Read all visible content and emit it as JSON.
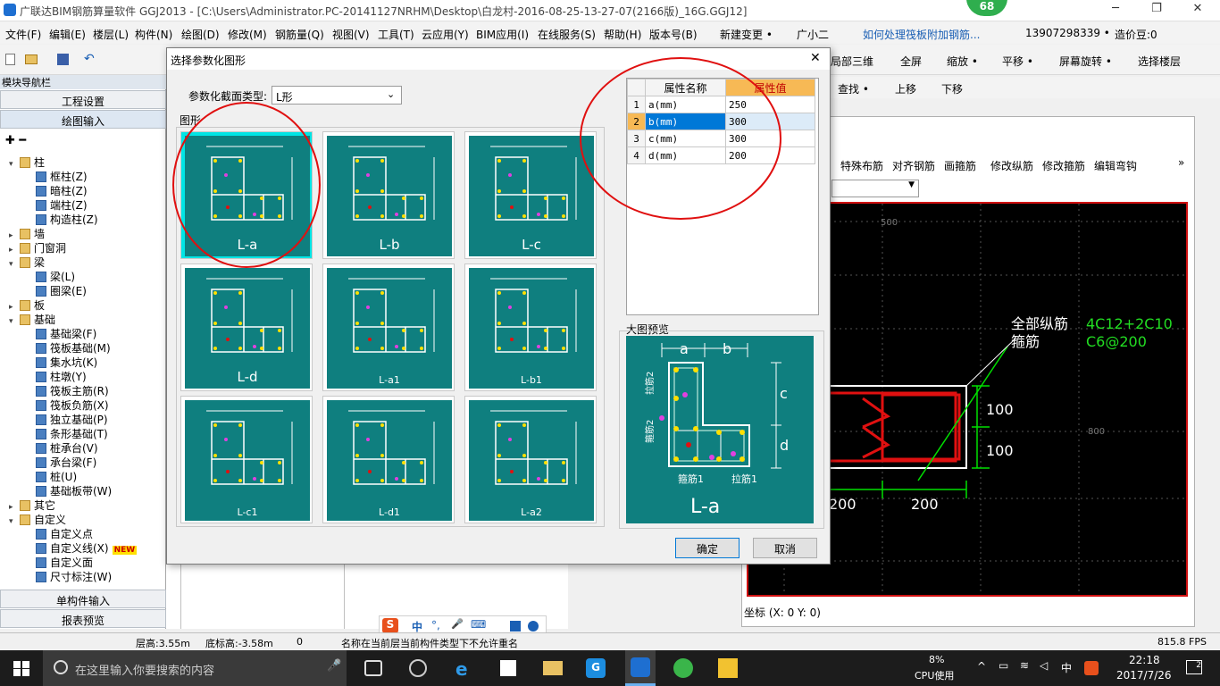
{
  "window": {
    "title": "广联达BIM钢筋算量软件 GGJ2013 - [C:\\Users\\Administrator.PC-20141127NRHM\\Desktop\\白龙村-2016-08-25-13-27-07(2166版)_16G.GGJ12]",
    "badge": "68",
    "minimize": "─",
    "maximize": "❐",
    "close": "✕"
  },
  "menu": [
    "文件(F)",
    "编辑(E)",
    "楼层(L)",
    "构件(N)",
    "绘图(D)",
    "修改(M)",
    "钢筋量(Q)",
    "视图(V)",
    "工具(T)",
    "云应用(Y)",
    "BIM应用(I)",
    "在线服务(S)",
    "帮助(H)",
    "版本号(B)",
    "新建变更 •",
    "广小二",
    "如何处理筏板附加钢筋...",
    "13907298339 •",
    "造价豆:0"
  ],
  "toolbar": {
    "items": [
      "局部三维",
      "全屏",
      "缩放 •",
      "平移 •",
      "屏幕旋转 •",
      "选择楼层"
    ],
    "row2": [
      "查找 •",
      "上移",
      "下移"
    ]
  },
  "nav": {
    "header": "模块导航栏",
    "buttons": [
      "工程设置",
      "绘图输入",
      "单构件输入",
      "报表预览"
    ],
    "tree": [
      {
        "t": "柱",
        "lvl": 0,
        "k": "folder",
        "open": true
      },
      {
        "t": "框柱(Z)",
        "lvl": 1,
        "k": "leaf"
      },
      {
        "t": "暗柱(Z)",
        "lvl": 1,
        "k": "leaf"
      },
      {
        "t": "端柱(Z)",
        "lvl": 1,
        "k": "leaf"
      },
      {
        "t": "构造柱(Z)",
        "lvl": 1,
        "k": "leaf"
      },
      {
        "t": "墙",
        "lvl": 0,
        "k": "folder"
      },
      {
        "t": "门窗洞",
        "lvl": 0,
        "k": "folder"
      },
      {
        "t": "梁",
        "lvl": 0,
        "k": "folder",
        "open": true
      },
      {
        "t": "梁(L)",
        "lvl": 1,
        "k": "leaf"
      },
      {
        "t": "圈梁(E)",
        "lvl": 1,
        "k": "leaf"
      },
      {
        "t": "板",
        "lvl": 0,
        "k": "folder"
      },
      {
        "t": "基础",
        "lvl": 0,
        "k": "folder",
        "open": true
      },
      {
        "t": "基础梁(F)",
        "lvl": 1,
        "k": "leaf"
      },
      {
        "t": "筏板基础(M)",
        "lvl": 1,
        "k": "leaf"
      },
      {
        "t": "集水坑(K)",
        "lvl": 1,
        "k": "leaf"
      },
      {
        "t": "柱墩(Y)",
        "lvl": 1,
        "k": "leaf"
      },
      {
        "t": "筏板主筋(R)",
        "lvl": 1,
        "k": "leaf"
      },
      {
        "t": "筏板负筋(X)",
        "lvl": 1,
        "k": "leaf"
      },
      {
        "t": "独立基础(P)",
        "lvl": 1,
        "k": "leaf"
      },
      {
        "t": "条形基础(T)",
        "lvl": 1,
        "k": "leaf"
      },
      {
        "t": "桩承台(V)",
        "lvl": 1,
        "k": "leaf"
      },
      {
        "t": "承台梁(F)",
        "lvl": 1,
        "k": "leaf"
      },
      {
        "t": "桩(U)",
        "lvl": 1,
        "k": "leaf"
      },
      {
        "t": "基础板带(W)",
        "lvl": 1,
        "k": "leaf"
      },
      {
        "t": "其它",
        "lvl": 0,
        "k": "folder"
      },
      {
        "t": "自定义",
        "lvl": 0,
        "k": "folder",
        "open": true
      },
      {
        "t": "自定义点",
        "lvl": 1,
        "k": "leaf"
      },
      {
        "t": "自定义线(X)",
        "lvl": 1,
        "k": "leaf",
        "badge": "NEW"
      },
      {
        "t": "自定义面",
        "lvl": 1,
        "k": "leaf"
      },
      {
        "t": "尺寸标注(W)",
        "lvl": 1,
        "k": "leaf"
      }
    ]
  },
  "right": {
    "tools": [
      "特殊布筋",
      "对齐钢筋",
      "画箍筋",
      "修改纵筋",
      "修改箍筋",
      "编辑弯钩"
    ],
    "more": "»",
    "coord": "坐标 (X: 0 Y: 0)",
    "canvas": {
      "label1": "全部纵筋",
      "label2": "箍筋",
      "value1": "4C12+2C10",
      "value2": "C6@200",
      "dim100a": "100",
      "dim100b": "100",
      "dim200a": "200",
      "dim200b": "200",
      "grid500": "500",
      "grid800": "800"
    }
  },
  "dialog": {
    "title": "选择参数化图形",
    "close": "✕",
    "type_label": "参数化截面类型:",
    "type_value": "L形",
    "shapes_label": "图形",
    "preview_label": "大图预览",
    "preview_name": "L-a",
    "ok": "确定",
    "cancel": "取消",
    "shapes": [
      {
        "name": "L-a",
        "sel": true
      },
      {
        "name": "L-b"
      },
      {
        "name": "L-c"
      },
      {
        "name": "L-d"
      },
      {
        "name": "L-a1",
        "sm": true
      },
      {
        "name": "L-b1",
        "sm": true
      },
      {
        "name": "L-c1",
        "sm": true
      },
      {
        "name": "L-d1",
        "sm": true
      },
      {
        "name": "L-a2",
        "sm": true
      }
    ],
    "table": {
      "headers": [
        "属性名称",
        "属性值"
      ],
      "rows": [
        {
          "n": "1",
          "name": "a(mm)",
          "val": "250"
        },
        {
          "n": "2",
          "name": "b(mm)",
          "val": "300",
          "sel": true
        },
        {
          "n": "3",
          "name": "c(mm)",
          "val": "300"
        },
        {
          "n": "4",
          "name": "d(mm)",
          "val": "200"
        }
      ]
    },
    "annot": {
      "hoop1": "箍筋1",
      "hoop2": "箍筋2",
      "tie1": "拉筋1",
      "tie2": "拉筋2",
      "a": "a",
      "b": "b",
      "c": "c",
      "d": "d"
    }
  },
  "ime": [
    "中",
    "°,",
    "🎤",
    "⌨"
  ],
  "status": {
    "floor_h": "层高:3.55m",
    "base_h": "底标高:-3.58m",
    "zero": "0",
    "msg": "名称在当前层当前构件类型下不允许重名",
    "fps": "815.8 FPS"
  },
  "taskbar": {
    "search": "在这里输入你要搜索的内容",
    "cpu": "8%",
    "cpu_label": "CPU使用",
    "ime": "中",
    "time": "22:18",
    "date": "2017/7/26",
    "notif": "2"
  }
}
